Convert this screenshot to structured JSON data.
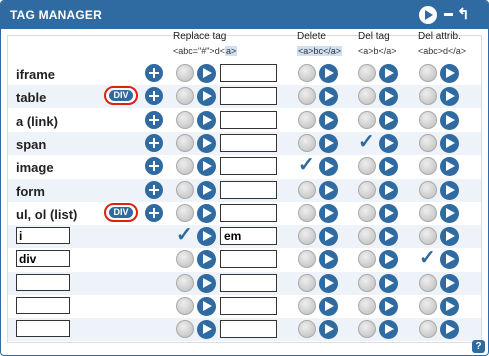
{
  "window": {
    "title": "TAG MANAGER",
    "help_label": "?"
  },
  "columns": {
    "replace": {
      "title": "Replace tag",
      "sample_a": "<a",
      "sample_b": "bc=\"#\">",
      "sample_c": "d<",
      "sample_d": "a>"
    },
    "delete": {
      "title": "Delete",
      "sample": "<a>bc</a>"
    },
    "deltag": {
      "title": "Del tag",
      "sample": "<a>b</a>"
    },
    "delattr": {
      "title": "Del attrib.",
      "sample_a": "<a",
      "sample_b": "bc>d</a>"
    }
  },
  "badge_label": "DIV",
  "rows": [
    {
      "label": "iframe",
      "badge": false,
      "plus": true,
      "replace_checked": false,
      "replace_value": "",
      "delete_checked": false,
      "deltag_checked": false,
      "delattr_checked": false
    },
    {
      "label": "table",
      "badge": true,
      "plus": true,
      "replace_checked": false,
      "replace_value": "",
      "delete_checked": false,
      "deltag_checked": false,
      "delattr_checked": false
    },
    {
      "label": "a (link)",
      "badge": false,
      "plus": true,
      "replace_checked": false,
      "replace_value": "",
      "delete_checked": false,
      "deltag_checked": false,
      "delattr_checked": false
    },
    {
      "label": "span",
      "badge": false,
      "plus": true,
      "replace_checked": false,
      "replace_value": "",
      "delete_checked": false,
      "deltag_checked": true,
      "delattr_checked": false
    },
    {
      "label": "image",
      "badge": false,
      "plus": true,
      "replace_checked": false,
      "replace_value": "",
      "delete_checked": true,
      "deltag_checked": false,
      "delattr_checked": false
    },
    {
      "label": "form",
      "badge": false,
      "plus": true,
      "replace_checked": false,
      "replace_value": "",
      "delete_checked": false,
      "deltag_checked": false,
      "delattr_checked": false
    },
    {
      "label": "ul, ol (list)",
      "badge": true,
      "plus": true,
      "replace_checked": false,
      "replace_value": "",
      "delete_checked": false,
      "deltag_checked": false,
      "delattr_checked": false
    },
    {
      "input": "i",
      "replace_checked": true,
      "replace_value": "em",
      "delete_checked": false,
      "deltag_checked": false,
      "delattr_checked": false
    },
    {
      "input": "div",
      "replace_checked": false,
      "replace_value": "",
      "delete_checked": false,
      "deltag_checked": false,
      "delattr_checked": true
    },
    {
      "input": "",
      "replace_checked": false,
      "replace_value": "",
      "delete_checked": false,
      "deltag_checked": false,
      "delattr_checked": false
    },
    {
      "input": "",
      "replace_checked": false,
      "replace_value": "",
      "delete_checked": false,
      "deltag_checked": false,
      "delattr_checked": false
    },
    {
      "input": "",
      "replace_checked": false,
      "replace_value": "",
      "delete_checked": false,
      "deltag_checked": false,
      "delattr_checked": false
    }
  ],
  "colors": {
    "accent": "#2f6aa0",
    "badge_border": "#dd2211"
  }
}
